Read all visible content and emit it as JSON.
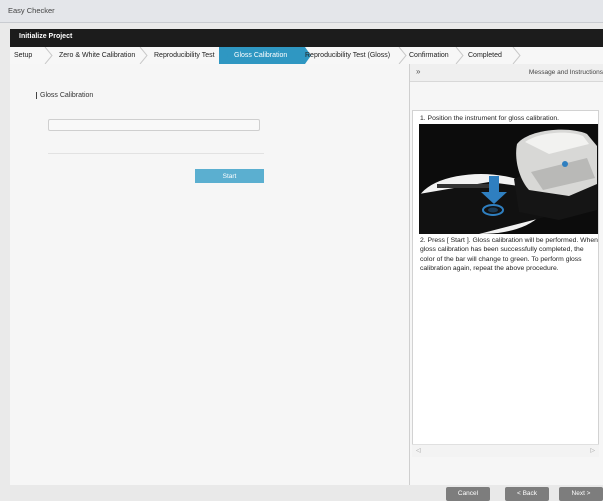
{
  "app": {
    "window_title": "Easy Checker",
    "header": "Initialize Project"
  },
  "steps": [
    {
      "label": "Setup"
    },
    {
      "label": "Zero & White Calibration"
    },
    {
      "label": "Reproducibility Test"
    },
    {
      "label": "Gloss Calibration",
      "active": true
    },
    {
      "label": "Reproducibility Test (Gloss)"
    },
    {
      "label": "Confirmation"
    },
    {
      "label": "Completed"
    }
  ],
  "main": {
    "section_label": "Gloss Calibration",
    "progress_percent": 0,
    "start_label": "Start"
  },
  "panel": {
    "collapse_icon": "double-chevron-right-icon",
    "collapse_glyph": "»",
    "title": "Message and Instructions",
    "step1": "1. Position the instrument for gloss calibration.",
    "step2": "2. Press [ Start ]. Gloss calibration will be performed. When gloss calibration has been successfully completed, the color of the bar will change to green. To perform gloss calibration again, repeat the above procedure.",
    "scroll_left": "◁",
    "scroll_right": "▷"
  },
  "footer": {
    "cancel": "Cancel",
    "back": "< Back",
    "next": "Next >"
  },
  "colors": {
    "accent": "#2f97c2",
    "start_button": "#5bafd0",
    "success": "#7cc576"
  }
}
